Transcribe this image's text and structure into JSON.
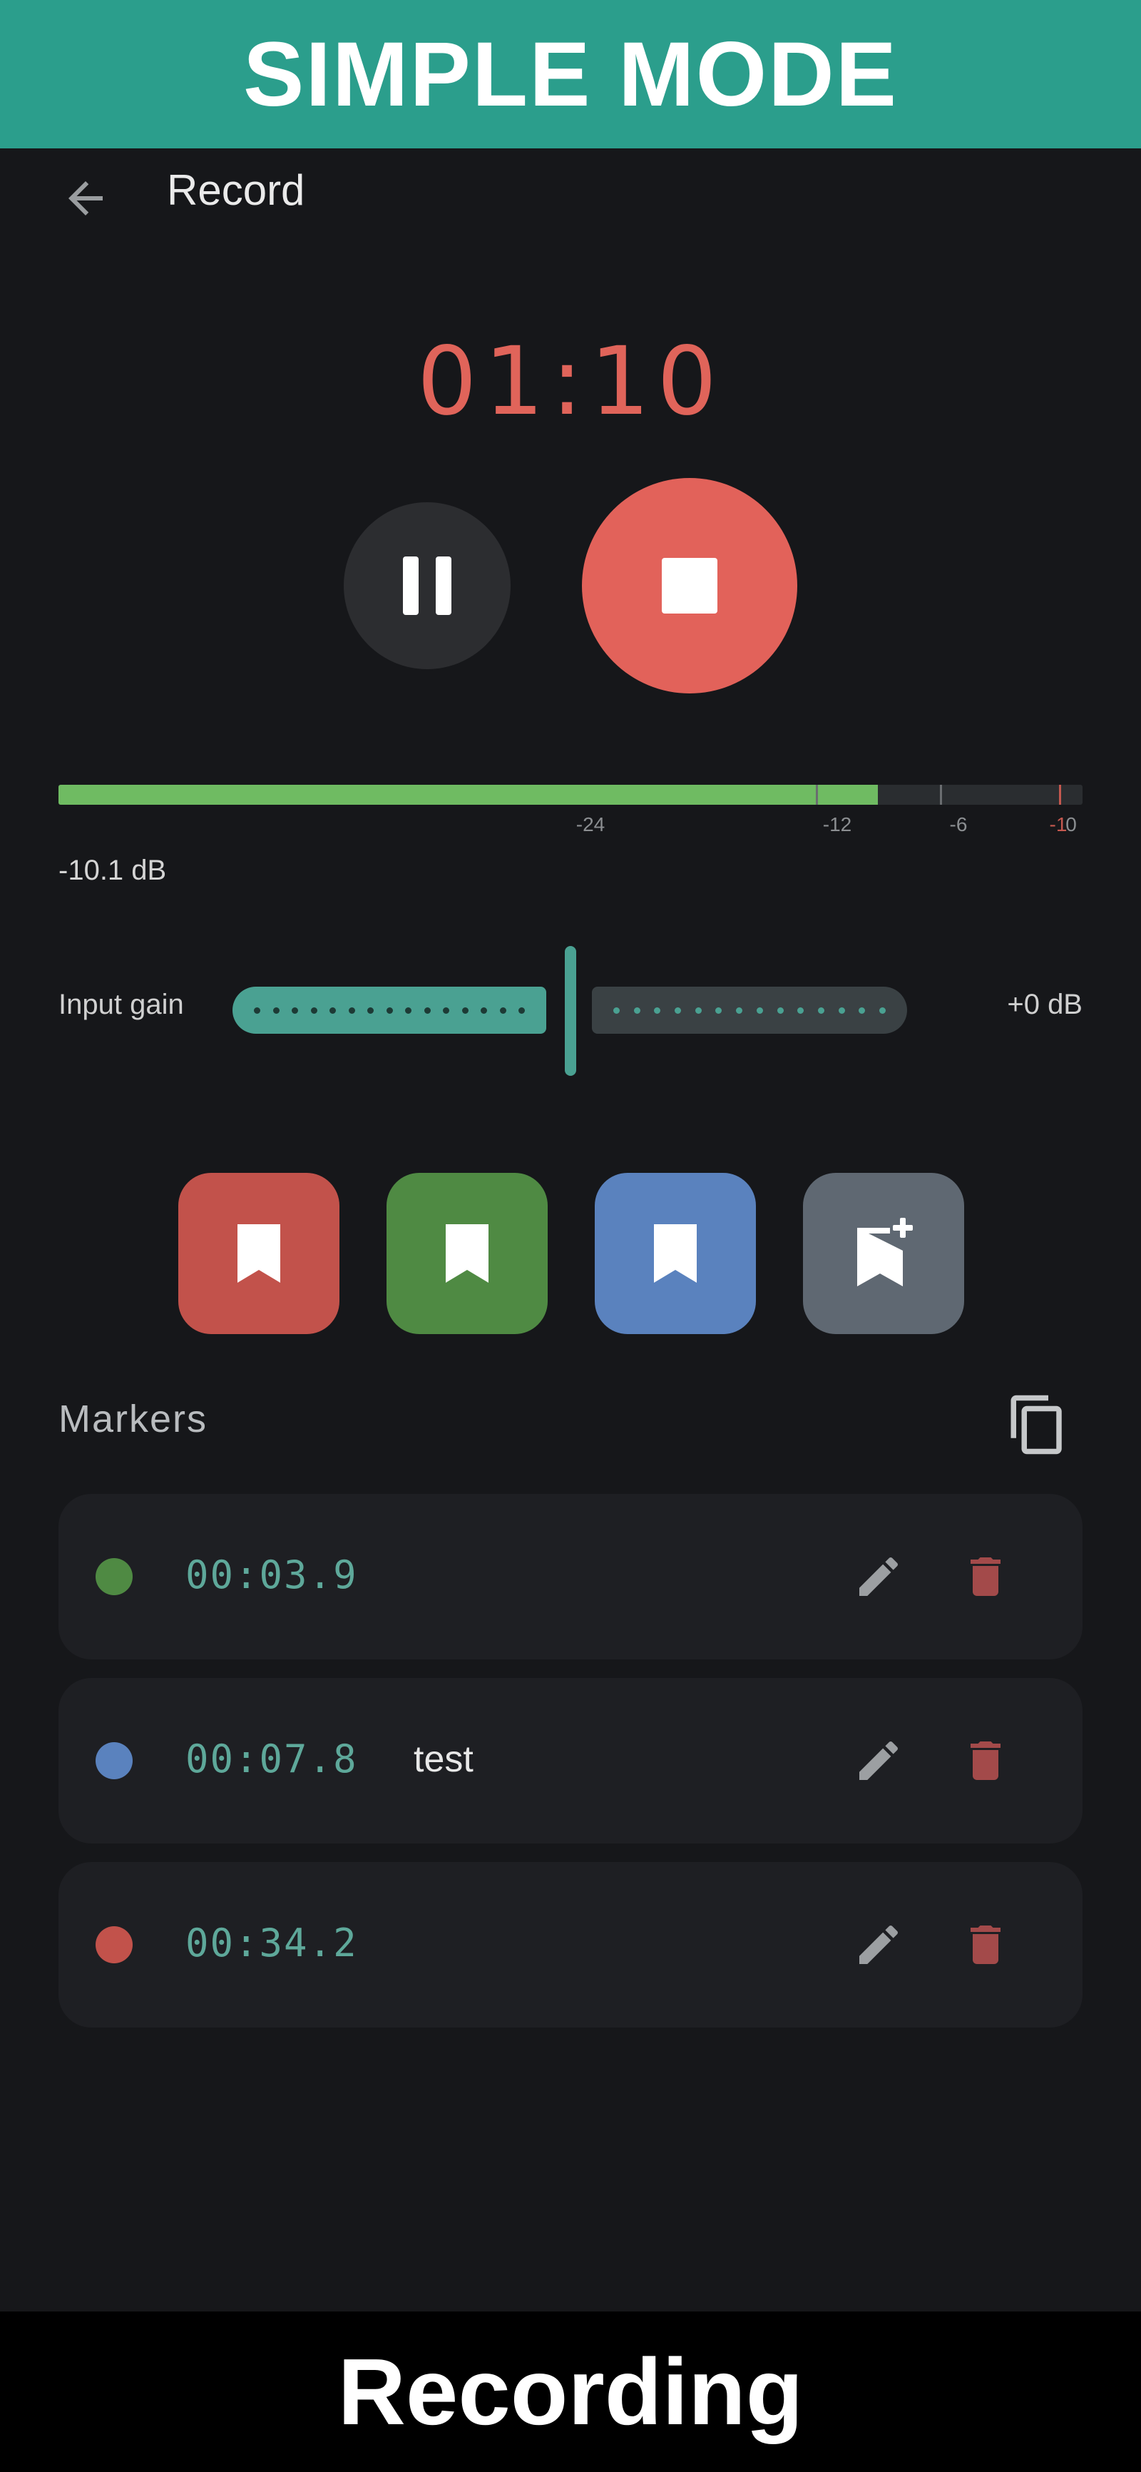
{
  "banner": {
    "title": "SIMPLE MODE"
  },
  "footer": {
    "caption": "Recording"
  },
  "topbar": {
    "back_icon": "arrow-left-icon",
    "title": "Record"
  },
  "recorder": {
    "timer": "01:10",
    "pause_icon": "pause-icon",
    "stop_icon": "stop-icon",
    "stop_color": "#e2625a",
    "level_fraction": 0.8,
    "level_readout": "-10.1 dB",
    "meter_color": "#6fbb62",
    "scale_labels": [
      "-24",
      "-12",
      "-6",
      "-1",
      "0"
    ]
  },
  "input_gain": {
    "label": "Input gain",
    "value": "+0 dB",
    "position_fraction": 0.5,
    "accent_color": "#4aa192"
  },
  "marker_buttons": [
    {
      "color": "#c2524b",
      "icon": "bookmark-icon"
    },
    {
      "color": "#4f8a43",
      "icon": "bookmark-icon"
    },
    {
      "color": "#5a82be",
      "icon": "bookmark-icon"
    },
    {
      "color": "#5f6872",
      "icon": "bookmark-add-icon"
    }
  ],
  "markers": {
    "title": "Markers",
    "copy_icon": "copy-icon",
    "items": [
      {
        "time": "00:03.9",
        "name": "",
        "color": "#4f8a43"
      },
      {
        "time": "00:07.8",
        "name": "test",
        "color": "#5a82be"
      },
      {
        "time": "00:34.2",
        "name": "",
        "color": "#c2524b"
      }
    ]
  }
}
